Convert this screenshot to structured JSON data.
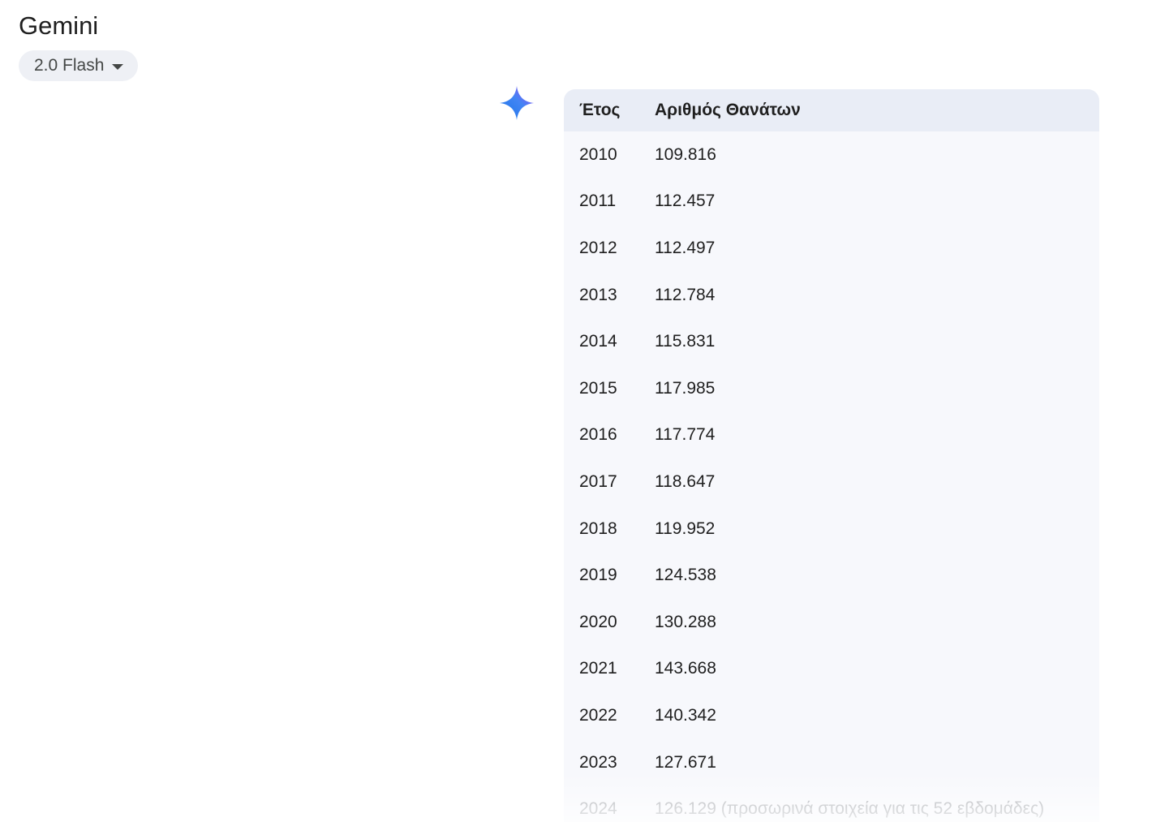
{
  "header": {
    "app_title": "Gemini",
    "model_label": "2.0 Flash",
    "model_caret_icon": "chevron-down-icon"
  },
  "response": {
    "avatar_icon": "gemini-spark-icon",
    "avatar_colors": [
      "#4285f4",
      "#1a73e8",
      "#a142f4"
    ],
    "table": {
      "headers": [
        "Έτος",
        "Αριθμός Θανάτων"
      ],
      "rows": [
        {
          "year": "2010",
          "deaths": "109.816"
        },
        {
          "year": "2011",
          "deaths": "112.457"
        },
        {
          "year": "2012",
          "deaths": "112.497"
        },
        {
          "year": "2013",
          "deaths": "112.784"
        },
        {
          "year": "2014",
          "deaths": "115.831"
        },
        {
          "year": "2015",
          "deaths": "117.985"
        },
        {
          "year": "2016",
          "deaths": "117.774"
        },
        {
          "year": "2017",
          "deaths": "118.647"
        },
        {
          "year": "2018",
          "deaths": "119.952"
        },
        {
          "year": "2019",
          "deaths": "124.538"
        },
        {
          "year": "2020",
          "deaths": "130.288"
        },
        {
          "year": "2021",
          "deaths": "143.668"
        },
        {
          "year": "2022",
          "deaths": "140.342"
        },
        {
          "year": "2023",
          "deaths": "127.671"
        },
        {
          "year": "2024",
          "deaths": "126.129 (προσωρινά στοιχεία για τις 52 εβδομάδες)"
        }
      ]
    }
  }
}
